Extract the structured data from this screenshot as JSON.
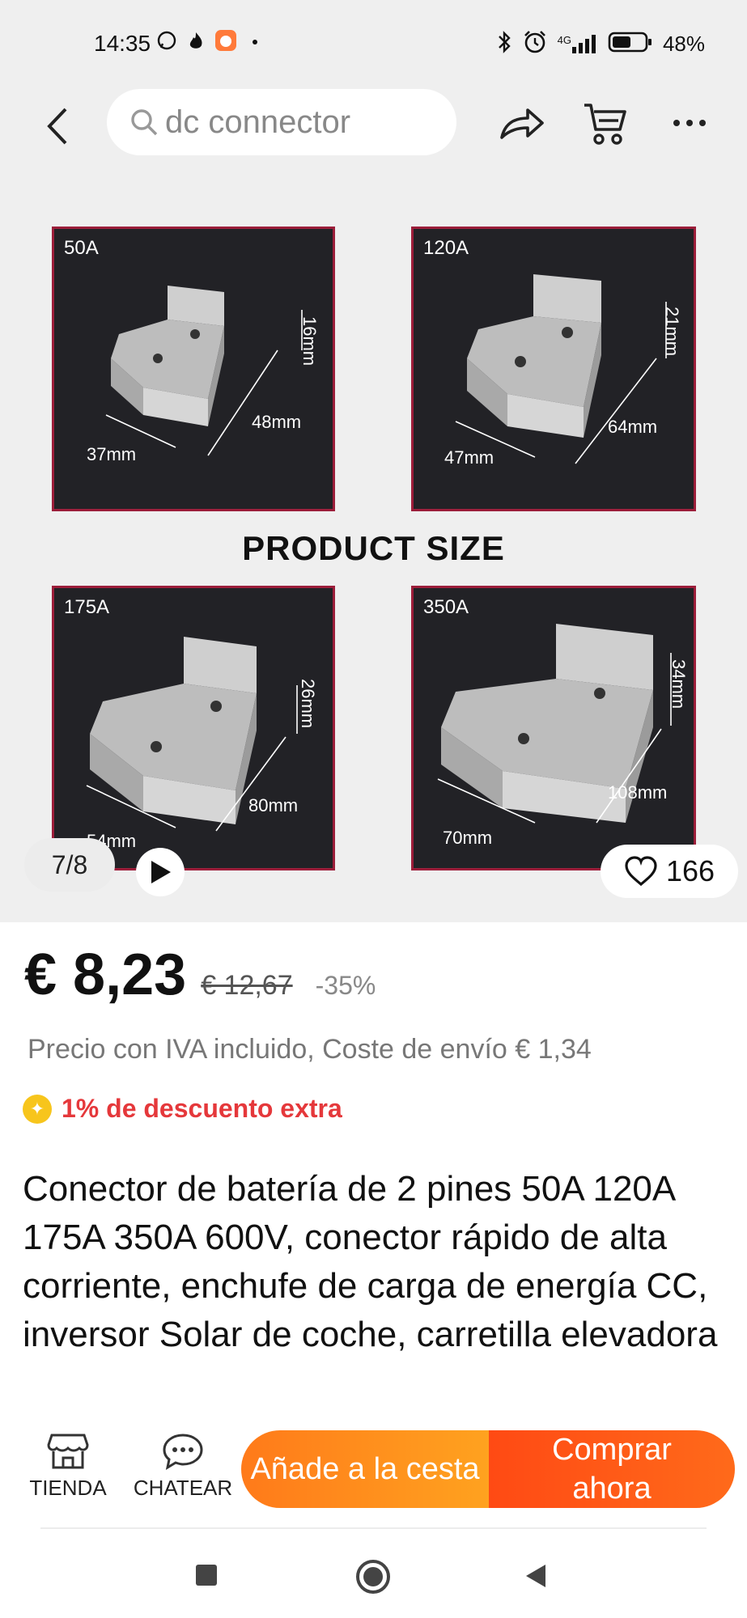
{
  "status_bar": {
    "time": "14:35",
    "battery_text": "48%",
    "network": "4G",
    "icons": [
      "whatsapp-icon",
      "flame-icon",
      "app-icon",
      "dot-icon",
      "bluetooth-icon",
      "alarm-icon",
      "signal-icon",
      "battery-icon"
    ]
  },
  "app_bar": {
    "search_placeholder": "dc connector"
  },
  "gallery": {
    "heading": "PRODUCT SIZE",
    "tiles": [
      {
        "label": "50A",
        "height": "16mm",
        "length": "48mm",
        "width": "37mm"
      },
      {
        "label": "120A",
        "height": "21mm",
        "length": "64mm",
        "width": "47mm"
      },
      {
        "label": "175A",
        "height": "26mm",
        "length": "80mm",
        "width": "54mm"
      },
      {
        "label": "350A",
        "height": "34mm",
        "length": "108mm",
        "width": "70mm"
      }
    ],
    "pager": "7/8",
    "likes": "166"
  },
  "product": {
    "price_now": "€ 8,23",
    "price_old": "€ 12,67",
    "discount_pct": "-35%",
    "tax_note": "Precio con IVA incluido, Coste de envío € 1,34",
    "extra_discount": "1% de descuento extra",
    "title": "Conector de batería de 2 pines 50A 120A 175A 350A 600V, conector rápido de alta corriente, enchufe de carga de energía CC, inversor Solar de coche, carretilla elevadora"
  },
  "bottom_bar": {
    "store_label": "TIENDA",
    "chat_label": "CHATEAR",
    "add_to_cart": "Añade a la cesta",
    "buy_now": "Comprar ahora"
  },
  "colors": {
    "accent_orange": "#ff8a1f",
    "buy_red": "#ff4a14",
    "discount_red": "#e5383b",
    "tile_border": "#9c1e3a"
  }
}
